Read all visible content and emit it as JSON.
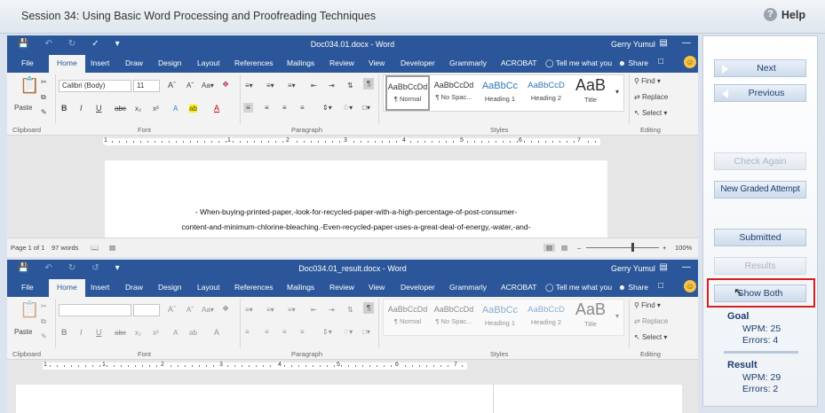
{
  "session": {
    "title": "Session 34: Using Basic Word Processing and Proofreading Techniques",
    "help_label": "Help"
  },
  "word": {
    "tabs": [
      "File",
      "Home",
      "Insert",
      "Draw",
      "Design",
      "Layout",
      "References",
      "Mailings",
      "Review",
      "View",
      "Developer",
      "Grammarly",
      "ACROBAT"
    ],
    "tell_me": "Tell me what you",
    "share": "Share",
    "user": "Gerry Yumul",
    "app": "Word",
    "font_name": "Calibri (Body)",
    "font_size": "11",
    "paste": "Paste",
    "find": "Find",
    "replace": "Replace",
    "select": "Select",
    "styles": [
      {
        "sample": "AaBbCcDd",
        "name": "¶ Normal"
      },
      {
        "sample": "AaBbCcDd",
        "name": "¶ No Spac..."
      },
      {
        "sample": "AaBbCc",
        "name": "Heading 1"
      },
      {
        "sample": "AaBbCcD",
        "name": "Heading 2"
      },
      {
        "sample": "AaB",
        "name": "Title"
      }
    ],
    "groups": {
      "clipboard": "Clipboard",
      "font": "Font",
      "paragraph": "Paragraph",
      "styles": "Styles",
      "editing": "Editing"
    },
    "ruler_numbers_top": [
      "1",
      "1",
      "2",
      "3",
      "4",
      "5",
      "6",
      "7"
    ],
    "ruler_numbers_bottom": [
      "1",
      "1",
      "2",
      "3",
      "4",
      "5",
      "6",
      "7"
    ]
  },
  "window1": {
    "doc_title": "Doc034.01.docx",
    "text_line1": "-      When-buying-printed-paper,-look-for-recycled-paper-with-a-high-percentage-of-post-consumer-",
    "text_line2": "content-and-minimum-chlorine-bleaching.-Even-recycled-paper-uses-a-great-deal-of-energy,-water,-and-",
    "page_info": "Page 1 of 1",
    "word_count": "97 words",
    "zoom": "100%"
  },
  "window2": {
    "doc_title": "Doc034.01_result.docx"
  },
  "panel": {
    "next": "Next",
    "previous": "Previous",
    "check_again": "Check Again",
    "new_attempt": "New Graded Attempt",
    "submitted": "Submitted",
    "results": "Results",
    "show_both": "Show Both",
    "goal": {
      "title": "Goal",
      "wpm": "WPM:  25",
      "errors": "Errors:  4"
    },
    "result": {
      "title": "Result",
      "wpm": "WPM:  29",
      "errors": "Errors:  2"
    }
  },
  "colors": {
    "word_blue": "#2b579a",
    "panel_text": "#1e3f70",
    "highlight_red": "#d61f1f"
  }
}
